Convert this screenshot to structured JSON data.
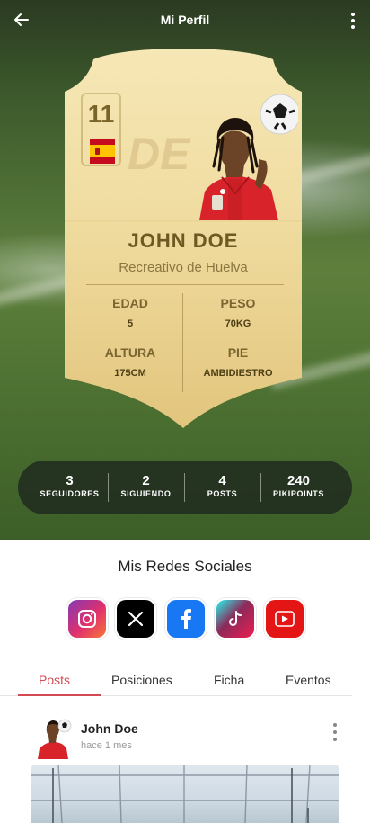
{
  "header": {
    "title": "Mi Perfil"
  },
  "card": {
    "rating": "11",
    "position_watermark": "DE",
    "nationality_flag": "spain-flag",
    "player_name": "JOHN DOE",
    "club": "Recreativo de Huelva",
    "stats": {
      "age_label": "EDAD",
      "age_value": "5",
      "weight_label": "PESO",
      "weight_value": "70KG",
      "height_label": "ALTURA",
      "height_value": "175CM",
      "foot_label": "PIE",
      "foot_value": "AMBIDIESTRO"
    },
    "colors": {
      "card_top": "#f6e7b6",
      "card_bottom": "#e2c57d",
      "text": "#6d5a23"
    }
  },
  "stats_bar": [
    {
      "value": "3",
      "label": "SEGUIDORES"
    },
    {
      "value": "2",
      "label": "SIGUIENDO"
    },
    {
      "value": "4",
      "label": "POSTS"
    },
    {
      "value": "240",
      "label": "PIKIPOINTS"
    }
  ],
  "social": {
    "title": "Mis Redes Sociales",
    "networks": [
      {
        "name": "instagram-icon",
        "color": "#e1306c"
      },
      {
        "name": "x-icon",
        "color": "#000000"
      },
      {
        "name": "facebook-icon",
        "color": "#1877f2"
      },
      {
        "name": "tiktok-icon",
        "color": "#ee1d52"
      },
      {
        "name": "youtube-icon",
        "color": "#ff0000"
      }
    ]
  },
  "tabs": {
    "items": [
      {
        "label": "Posts",
        "active": true
      },
      {
        "label": "Posiciones",
        "active": false
      },
      {
        "label": "Ficha",
        "active": false
      },
      {
        "label": "Eventos",
        "active": false
      }
    ],
    "accent": "#d34a54"
  },
  "post": {
    "author": "John Doe",
    "time": "hace 1 mes"
  }
}
